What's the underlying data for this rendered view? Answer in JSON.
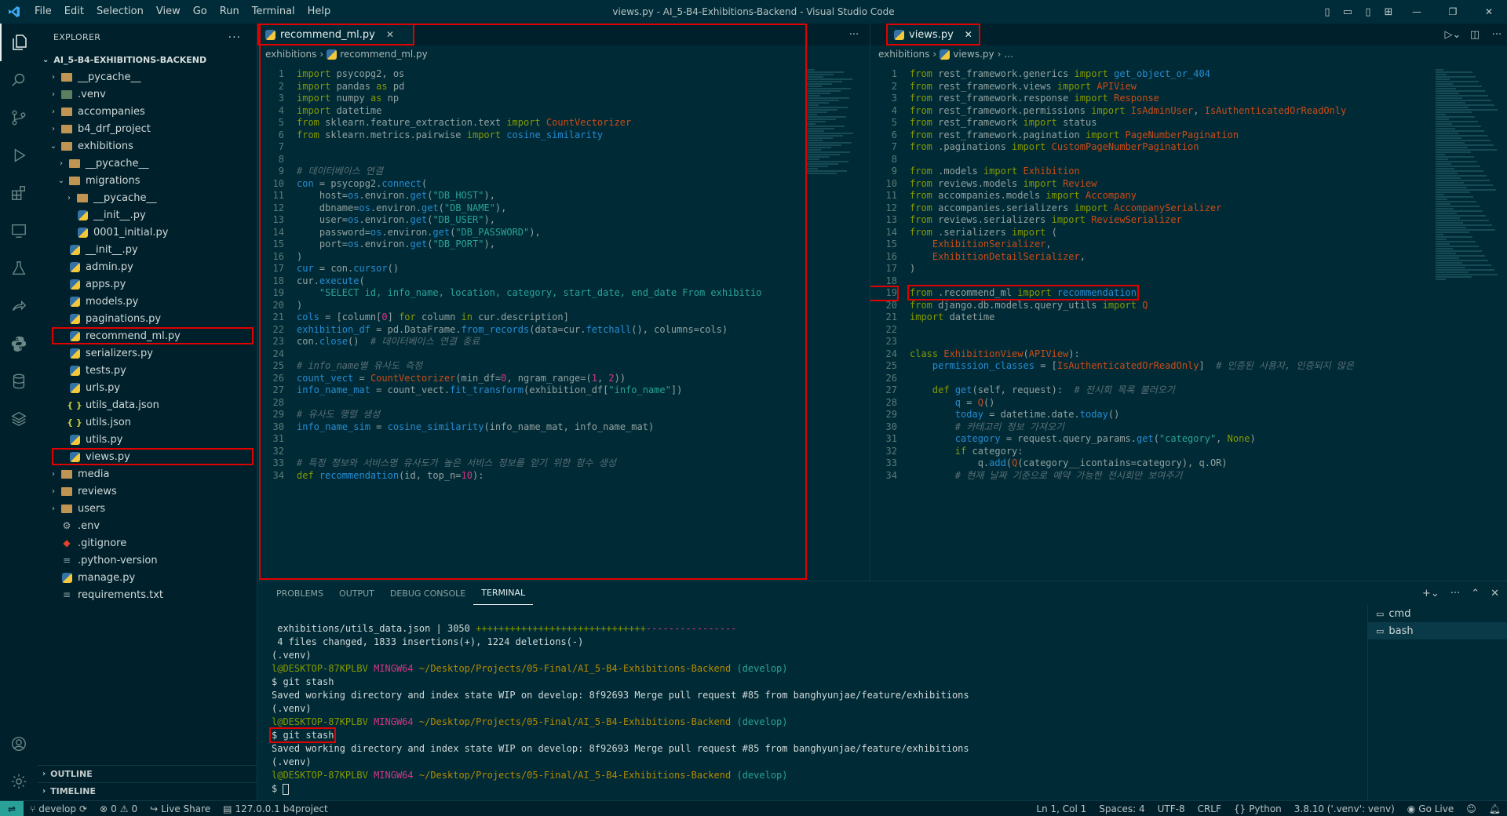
{
  "window": {
    "title": "views.py - AI_5-B4-Exhibitions-Backend - Visual Studio Code",
    "menu": [
      "File",
      "Edit",
      "Selection",
      "View",
      "Go",
      "Run",
      "Terminal",
      "Help"
    ]
  },
  "explorer": {
    "header": "EXPLORER",
    "root": "AI_5-B4-EXHIBITIONS-BACKEND",
    "tree": [
      {
        "label": "__pycache__",
        "depth": 1,
        "type": "folder",
        "open": false
      },
      {
        "label": ".venv",
        "depth": 1,
        "type": "venv",
        "open": false
      },
      {
        "label": "accompanies",
        "depth": 1,
        "type": "folder",
        "open": false
      },
      {
        "label": "b4_drf_project",
        "depth": 1,
        "type": "folder",
        "open": false
      },
      {
        "label": "exhibitions",
        "depth": 1,
        "type": "folder",
        "open": true
      },
      {
        "label": "__pycache__",
        "depth": 2,
        "type": "folder",
        "open": false
      },
      {
        "label": "migrations",
        "depth": 2,
        "type": "folder",
        "open": true
      },
      {
        "label": "__pycache__",
        "depth": 3,
        "type": "folder",
        "open": false
      },
      {
        "label": "__init__.py",
        "depth": 3,
        "type": "py"
      },
      {
        "label": "0001_initial.py",
        "depth": 3,
        "type": "py"
      },
      {
        "label": "__init__.py",
        "depth": 2,
        "type": "py"
      },
      {
        "label": "admin.py",
        "depth": 2,
        "type": "py"
      },
      {
        "label": "apps.py",
        "depth": 2,
        "type": "py"
      },
      {
        "label": "models.py",
        "depth": 2,
        "type": "py"
      },
      {
        "label": "paginations.py",
        "depth": 2,
        "type": "py"
      },
      {
        "label": "recommend_ml.py",
        "depth": 2,
        "type": "py",
        "highlight": true
      },
      {
        "label": "serializers.py",
        "depth": 2,
        "type": "py"
      },
      {
        "label": "tests.py",
        "depth": 2,
        "type": "py"
      },
      {
        "label": "urls.py",
        "depth": 2,
        "type": "py"
      },
      {
        "label": "utils_data.json",
        "depth": 2,
        "type": "json"
      },
      {
        "label": "utils.json",
        "depth": 2,
        "type": "json"
      },
      {
        "label": "utils.py",
        "depth": 2,
        "type": "py"
      },
      {
        "label": "views.py",
        "depth": 2,
        "type": "py",
        "highlight": true
      },
      {
        "label": "media",
        "depth": 1,
        "type": "folder",
        "open": false
      },
      {
        "label": "reviews",
        "depth": 1,
        "type": "folder",
        "open": false
      },
      {
        "label": "users",
        "depth": 1,
        "type": "folder",
        "open": false
      },
      {
        "label": ".env",
        "depth": 1,
        "type": "gear"
      },
      {
        "label": ".gitignore",
        "depth": 1,
        "type": "git"
      },
      {
        "label": ".python-version",
        "depth": 1,
        "type": "txt"
      },
      {
        "label": "manage.py",
        "depth": 1,
        "type": "py"
      },
      {
        "label": "requirements.txt",
        "depth": 1,
        "type": "txt"
      }
    ],
    "outline": "OUTLINE",
    "timeline": "TIMELINE"
  },
  "editor_left": {
    "tab": "recommend_ml.py",
    "breadcrumb": [
      "exhibitions",
      "recommend_ml.py"
    ],
    "lines": [
      [
        [
          "k",
          "import "
        ],
        [
          "p",
          "psycopg2, os"
        ]
      ],
      [
        [
          "k",
          "import "
        ],
        [
          "p",
          "pandas "
        ],
        [
          "k",
          "as "
        ],
        [
          "p",
          "pd"
        ]
      ],
      [
        [
          "k",
          "import "
        ],
        [
          "p",
          "numpy "
        ],
        [
          "k",
          "as "
        ],
        [
          "p",
          "np"
        ]
      ],
      [
        [
          "k",
          "import "
        ],
        [
          "p",
          "datetime"
        ]
      ],
      [
        [
          "k",
          "from "
        ],
        [
          "p",
          "sklearn.feature_extraction.text "
        ],
        [
          "k",
          "import "
        ],
        [
          "t",
          "CountVectorizer"
        ]
      ],
      [
        [
          "k",
          "from "
        ],
        [
          "p",
          "sklearn.metrics.pairwise "
        ],
        [
          "k",
          "import "
        ],
        [
          "f",
          "cosine_similarity"
        ]
      ],
      [],
      [],
      [
        [
          "c",
          "# 데이터베이스 연결"
        ]
      ],
      [
        [
          "v",
          "con "
        ],
        [
          "p",
          "= psycopg2."
        ],
        [
          "f",
          "connect"
        ],
        [
          "p",
          "("
        ]
      ],
      [
        [
          "p",
          "    host="
        ],
        [
          "v",
          "os"
        ],
        [
          "p",
          ".environ."
        ],
        [
          "f",
          "get"
        ],
        [
          "p",
          "("
        ],
        [
          "s",
          "\"DB_HOST\""
        ],
        [
          "p",
          "),"
        ]
      ],
      [
        [
          "p",
          "    dbname="
        ],
        [
          "v",
          "os"
        ],
        [
          "p",
          ".environ."
        ],
        [
          "f",
          "get"
        ],
        [
          "p",
          "("
        ],
        [
          "s",
          "\"DB_NAME\""
        ],
        [
          "p",
          "),"
        ]
      ],
      [
        [
          "p",
          "    user="
        ],
        [
          "v",
          "os"
        ],
        [
          "p",
          ".environ."
        ],
        [
          "f",
          "get"
        ],
        [
          "p",
          "("
        ],
        [
          "s",
          "\"DB_USER\""
        ],
        [
          "p",
          "),"
        ]
      ],
      [
        [
          "p",
          "    password="
        ],
        [
          "v",
          "os"
        ],
        [
          "p",
          ".environ."
        ],
        [
          "f",
          "get"
        ],
        [
          "p",
          "("
        ],
        [
          "s",
          "\"DB_PASSWORD\""
        ],
        [
          "p",
          "),"
        ]
      ],
      [
        [
          "p",
          "    port="
        ],
        [
          "v",
          "os"
        ],
        [
          "p",
          ".environ."
        ],
        [
          "f",
          "get"
        ],
        [
          "p",
          "("
        ],
        [
          "s",
          "\"DB_PORT\""
        ],
        [
          "p",
          "),"
        ]
      ],
      [
        [
          "p",
          ")"
        ]
      ],
      [
        [
          "v",
          "cur "
        ],
        [
          "p",
          "= con."
        ],
        [
          "f",
          "cursor"
        ],
        [
          "p",
          "()"
        ]
      ],
      [
        [
          "p",
          "cur."
        ],
        [
          "f",
          "execute"
        ],
        [
          "p",
          "("
        ]
      ],
      [
        [
          "s",
          "    \"SELECT id, info_name, location, category, start_date, end_date From exhibitio"
        ]
      ],
      [
        [
          "p",
          ")"
        ]
      ],
      [
        [
          "v",
          "cols "
        ],
        [
          "p",
          "= [column["
        ],
        [
          "n",
          "0"
        ],
        [
          "p",
          "] "
        ],
        [
          "k",
          "for "
        ],
        [
          "p",
          "column "
        ],
        [
          "k",
          "in "
        ],
        [
          "p",
          "cur.description]"
        ]
      ],
      [
        [
          "v",
          "exhibition_df "
        ],
        [
          "p",
          "= pd.DataFrame."
        ],
        [
          "f",
          "from_records"
        ],
        [
          "p",
          "(data=cur."
        ],
        [
          "f",
          "fetchall"
        ],
        [
          "p",
          "(), columns=cols)"
        ]
      ],
      [
        [
          "p",
          "con."
        ],
        [
          "f",
          "close"
        ],
        [
          "p",
          "()  "
        ],
        [
          "c",
          "# 데이터베이스 연결 종료"
        ]
      ],
      [],
      [
        [
          "c",
          "# info_name별 유사도 측정"
        ]
      ],
      [
        [
          "v",
          "count_vect "
        ],
        [
          "p",
          "= "
        ],
        [
          "t",
          "CountVectorizer"
        ],
        [
          "p",
          "(min_df="
        ],
        [
          "n",
          "0"
        ],
        [
          "p",
          ", ngram_range=("
        ],
        [
          "n",
          "1"
        ],
        [
          "p",
          ", "
        ],
        [
          "n",
          "2"
        ],
        [
          "p",
          "))"
        ]
      ],
      [
        [
          "v",
          "info_name_mat "
        ],
        [
          "p",
          "= count_vect."
        ],
        [
          "f",
          "fit_transform"
        ],
        [
          "p",
          "(exhibition_df["
        ],
        [
          "s",
          "\"info_name\""
        ],
        [
          "p",
          "])"
        ]
      ],
      [],
      [
        [
          "c",
          "# 유사도 행렬 생성"
        ]
      ],
      [
        [
          "v",
          "info_name_sim "
        ],
        [
          "p",
          "= "
        ],
        [
          "f",
          "cosine_similarity"
        ],
        [
          "p",
          "(info_name_mat, info_name_mat)"
        ]
      ],
      [],
      [],
      [
        [
          "c",
          "# 특정 정보와 서비스명 유사도가 높은 서비스 정보를 얻기 위한 함수 생성"
        ]
      ],
      [
        [
          "k",
          "def "
        ],
        [
          "f",
          "recommendation"
        ],
        [
          "p",
          "(id, top_n="
        ],
        [
          "n",
          "10"
        ],
        [
          "p",
          "):"
        ]
      ]
    ]
  },
  "editor_right": {
    "tab": "views.py",
    "breadcrumb": [
      "exhibitions",
      "views.py",
      "..."
    ],
    "lines": [
      [
        [
          "k",
          "from "
        ],
        [
          "p",
          "rest_framework.generics "
        ],
        [
          "k",
          "import "
        ],
        [
          "f",
          "get_object_or_404"
        ]
      ],
      [
        [
          "k",
          "from "
        ],
        [
          "p",
          "rest_framework.views "
        ],
        [
          "k",
          "import "
        ],
        [
          "t",
          "APIView"
        ]
      ],
      [
        [
          "k",
          "from "
        ],
        [
          "p",
          "rest_framework.response "
        ],
        [
          "k",
          "import "
        ],
        [
          "t",
          "Response"
        ]
      ],
      [
        [
          "k",
          "from "
        ],
        [
          "p",
          "rest_framework.permissions "
        ],
        [
          "k",
          "import "
        ],
        [
          "t",
          "IsAdminUser"
        ],
        [
          "p",
          ", "
        ],
        [
          "t",
          "IsAuthenticatedOrReadOnly"
        ]
      ],
      [
        [
          "k",
          "from "
        ],
        [
          "p",
          "rest_framework "
        ],
        [
          "k",
          "import "
        ],
        [
          "p",
          "status"
        ]
      ],
      [
        [
          "k",
          "from "
        ],
        [
          "p",
          "rest_framework.pagination "
        ],
        [
          "k",
          "import "
        ],
        [
          "t",
          "PageNumberPagination"
        ]
      ],
      [
        [
          "k",
          "from "
        ],
        [
          "p",
          ".paginations "
        ],
        [
          "k",
          "import "
        ],
        [
          "t",
          "CustomPageNumberPagination"
        ]
      ],
      [],
      [
        [
          "k",
          "from "
        ],
        [
          "p",
          ".models "
        ],
        [
          "k",
          "import "
        ],
        [
          "t",
          "Exhibition"
        ]
      ],
      [
        [
          "k",
          "from "
        ],
        [
          "p",
          "reviews.models "
        ],
        [
          "k",
          "import "
        ],
        [
          "t",
          "Review"
        ]
      ],
      [
        [
          "k",
          "from "
        ],
        [
          "p",
          "accompanies.models "
        ],
        [
          "k",
          "import "
        ],
        [
          "t",
          "Accompany"
        ]
      ],
      [
        [
          "k",
          "from "
        ],
        [
          "p",
          "accompanies.serializers "
        ],
        [
          "k",
          "import "
        ],
        [
          "t",
          "AccompanySerializer"
        ]
      ],
      [
        [
          "k",
          "from "
        ],
        [
          "p",
          "reviews.serializers "
        ],
        [
          "k",
          "import "
        ],
        [
          "t",
          "ReviewSerializer"
        ]
      ],
      [
        [
          "k",
          "from "
        ],
        [
          "p",
          ".serializers "
        ],
        [
          "k",
          "import "
        ],
        [
          "p",
          "("
        ]
      ],
      [
        [
          "t",
          "    ExhibitionSerializer"
        ],
        [
          "p",
          ","
        ]
      ],
      [
        [
          "t",
          "    ExhibitionDetailSerializer"
        ],
        [
          "p",
          ","
        ]
      ],
      [
        [
          "p",
          ")"
        ]
      ],
      [],
      [
        [
          "k",
          "from "
        ],
        [
          "p",
          ".recommend_ml "
        ],
        [
          "k",
          "import "
        ],
        [
          "f",
          "recommendation"
        ]
      ],
      [
        [
          "k",
          "from "
        ],
        [
          "p",
          "django.db.models.query_utils "
        ],
        [
          "k",
          "import "
        ],
        [
          "t",
          "Q"
        ]
      ],
      [
        [
          "k",
          "import "
        ],
        [
          "p",
          "datetime"
        ]
      ],
      [],
      [],
      [
        [
          "k",
          "class "
        ],
        [
          "t",
          "ExhibitionView"
        ],
        [
          "p",
          "("
        ],
        [
          "t",
          "APIView"
        ],
        [
          "p",
          "):"
        ]
      ],
      [
        [
          "p",
          "    "
        ],
        [
          "v",
          "permission_classes "
        ],
        [
          "p",
          "= ["
        ],
        [
          "t",
          "IsAuthenticatedOrReadOnly"
        ],
        [
          "p",
          "]  "
        ],
        [
          "c",
          "# 인증된 사용자, 인증되지 않은"
        ]
      ],
      [],
      [
        [
          "p",
          "    "
        ],
        [
          "k",
          "def "
        ],
        [
          "f",
          "get"
        ],
        [
          "p",
          "(self, request):  "
        ],
        [
          "c",
          "# 전시회 목록 불러오기"
        ]
      ],
      [
        [
          "p",
          "        "
        ],
        [
          "v",
          "q "
        ],
        [
          "p",
          "= "
        ],
        [
          "t",
          "Q"
        ],
        [
          "p",
          "()"
        ]
      ],
      [
        [
          "p",
          "        "
        ],
        [
          "v",
          "today "
        ],
        [
          "p",
          "= datetime.date."
        ],
        [
          "f",
          "today"
        ],
        [
          "p",
          "()"
        ]
      ],
      [
        [
          "c",
          "        # 카테고리 정보 가져오기"
        ]
      ],
      [
        [
          "p",
          "        "
        ],
        [
          "v",
          "category "
        ],
        [
          "p",
          "= request.query_params."
        ],
        [
          "f",
          "get"
        ],
        [
          "p",
          "("
        ],
        [
          "s",
          "\"category\""
        ],
        [
          "p",
          ", "
        ],
        [
          "k",
          "None"
        ],
        [
          "p",
          ")"
        ]
      ],
      [
        [
          "p",
          "        "
        ],
        [
          "k",
          "if "
        ],
        [
          "p",
          "category:"
        ]
      ],
      [
        [
          "p",
          "            q."
        ],
        [
          "f",
          "add"
        ],
        [
          "p",
          "("
        ],
        [
          "t",
          "Q"
        ],
        [
          "p",
          "(category__icontains=category), q.OR)"
        ]
      ],
      [
        [
          "c",
          "        # 현재 날짜 기준으로 예약 가능한 전시회만 보여주기"
        ]
      ]
    ]
  },
  "panel": {
    "tabs": [
      "PROBLEMS",
      "OUTPUT",
      "DEBUG CONSOLE",
      "TERMINAL"
    ],
    "active_tab": "TERMINAL",
    "terminal_lines": [
      " exhibitions/utils_data.json | 3050 ++++++++++++++++++++++++++++++----------------",
      " 4 files changed, 1833 insertions(+), 1224 deletions(-)",
      "(.venv)",
      "PROMPT",
      "$ git stash",
      "Saved working directory and index state WIP on develop: 8f92693 Merge pull request #85 from banghyunjae/feature/exhibitions",
      "(.venv)",
      "PROMPT",
      "$ git stash",
      "Saved working directory and index state WIP on develop: 8f92693 Merge pull request #85 from banghyunjae/feature/exhibitions",
      "(.venv)",
      "PROMPT",
      "$ "
    ],
    "prompt": {
      "user": "l@DESKTOP-87KPLBV",
      "shell": "MINGW64",
      "path": "~/Desktop/Projects/05-Final/AI_5-B4-Exhibitions-Backend",
      "branch": "(develop)"
    },
    "terminals": [
      "cmd",
      "bash"
    ]
  },
  "statusbar": {
    "branch": "develop",
    "problems": "0",
    "warnings": "0",
    "live_share": "Live Share",
    "server": "127.0.0.1",
    "project": "b4project",
    "position": "Ln 1, Col 1",
    "spaces": "Spaces: 4",
    "encoding": "UTF-8",
    "eol": "CRLF",
    "language": "Python",
    "interpreter": "3.8.10 ('.venv': venv)",
    "go_live": "Go Live"
  }
}
